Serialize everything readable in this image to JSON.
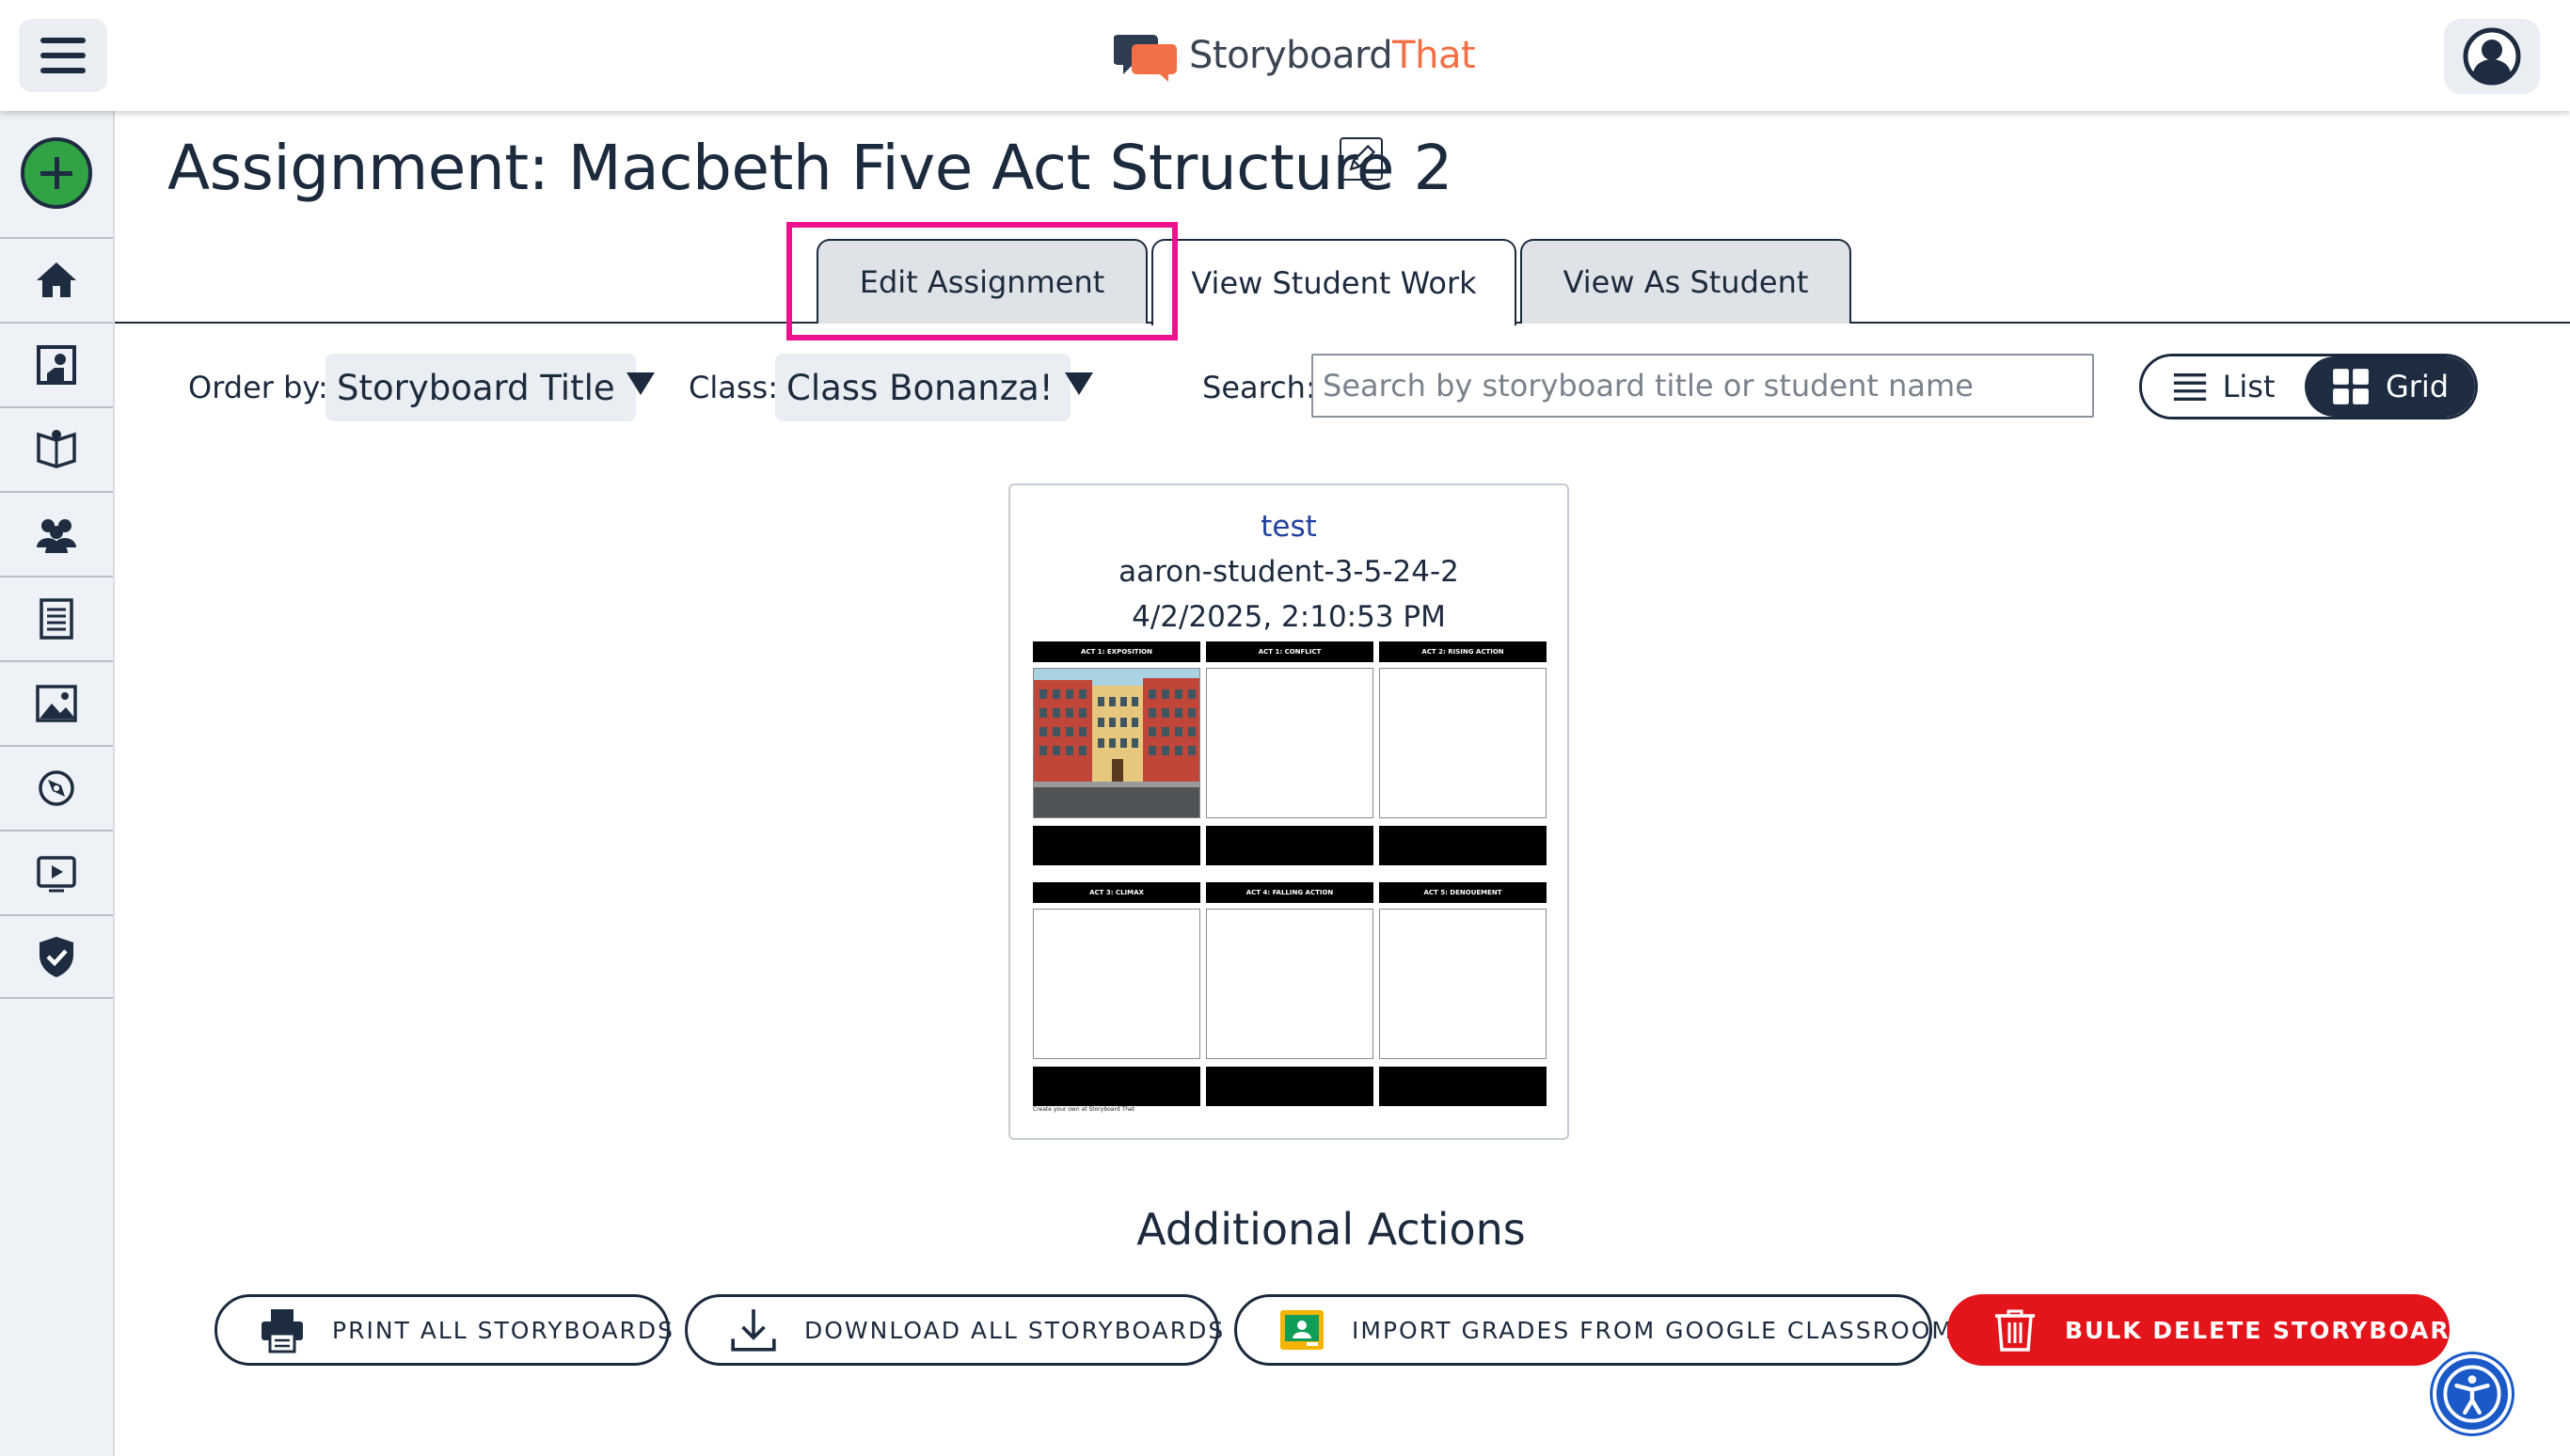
{
  "header": {
    "logo_part1": "Storyboard",
    "logo_part2": "That",
    "brand_color": "#f36f45"
  },
  "sidebar": {
    "items": [
      {
        "icon": "home-icon"
      },
      {
        "icon": "student-board-icon"
      },
      {
        "icon": "open-book-icon"
      },
      {
        "icon": "people-icon"
      },
      {
        "icon": "document-list-icon"
      },
      {
        "icon": "image-icon"
      },
      {
        "icon": "compass-icon"
      },
      {
        "icon": "video-icon"
      },
      {
        "icon": "shield-check-icon"
      }
    ]
  },
  "page": {
    "title": "Assignment: Macbeth Five Act Structure 2"
  },
  "tabs": [
    {
      "label": "Edit Assignment",
      "state": "inactive"
    },
    {
      "label": "View Student Work",
      "state": "active"
    },
    {
      "label": "View As Student",
      "state": "inactive"
    }
  ],
  "filters": {
    "order_label": "Order by:",
    "order_value": "Storyboard Title",
    "class_label": "Class:",
    "class_value": "Class Bonanza!",
    "search_label": "Search:",
    "search_placeholder": "Search by storyboard title or student name",
    "search_value": "",
    "view_list_label": "List",
    "view_grid_label": "Grid",
    "view_selected": "Grid"
  },
  "card": {
    "title": "test",
    "student": "aaron-student-3-5-24-2",
    "date": "4/2/2025, 2:10:53 PM",
    "storyboard": {
      "cells": [
        {
          "heading": "ACT 1: EXPOSITION"
        },
        {
          "heading": "ACT 1: CONFLICT"
        },
        {
          "heading": "ACT 2: RISING ACTION"
        },
        {
          "heading": "ACT 3: CLIMAX"
        },
        {
          "heading": "ACT 4: FALLING ACTION"
        },
        {
          "heading": "ACT 5: DENOUEMENT"
        }
      ],
      "footer": "Create your own at Storyboard That"
    }
  },
  "actions": {
    "title": "Additional Actions",
    "print_label": "PRINT ALL STORYBOARDS",
    "download_label": "DOWNLOAD ALL STORYBOARDS",
    "import_label": "IMPORT GRADES FROM GOOGLE CLASSROOM",
    "delete_label": "BULK DELETE STORYBOARDS",
    "delete_color": "#e4141b"
  }
}
